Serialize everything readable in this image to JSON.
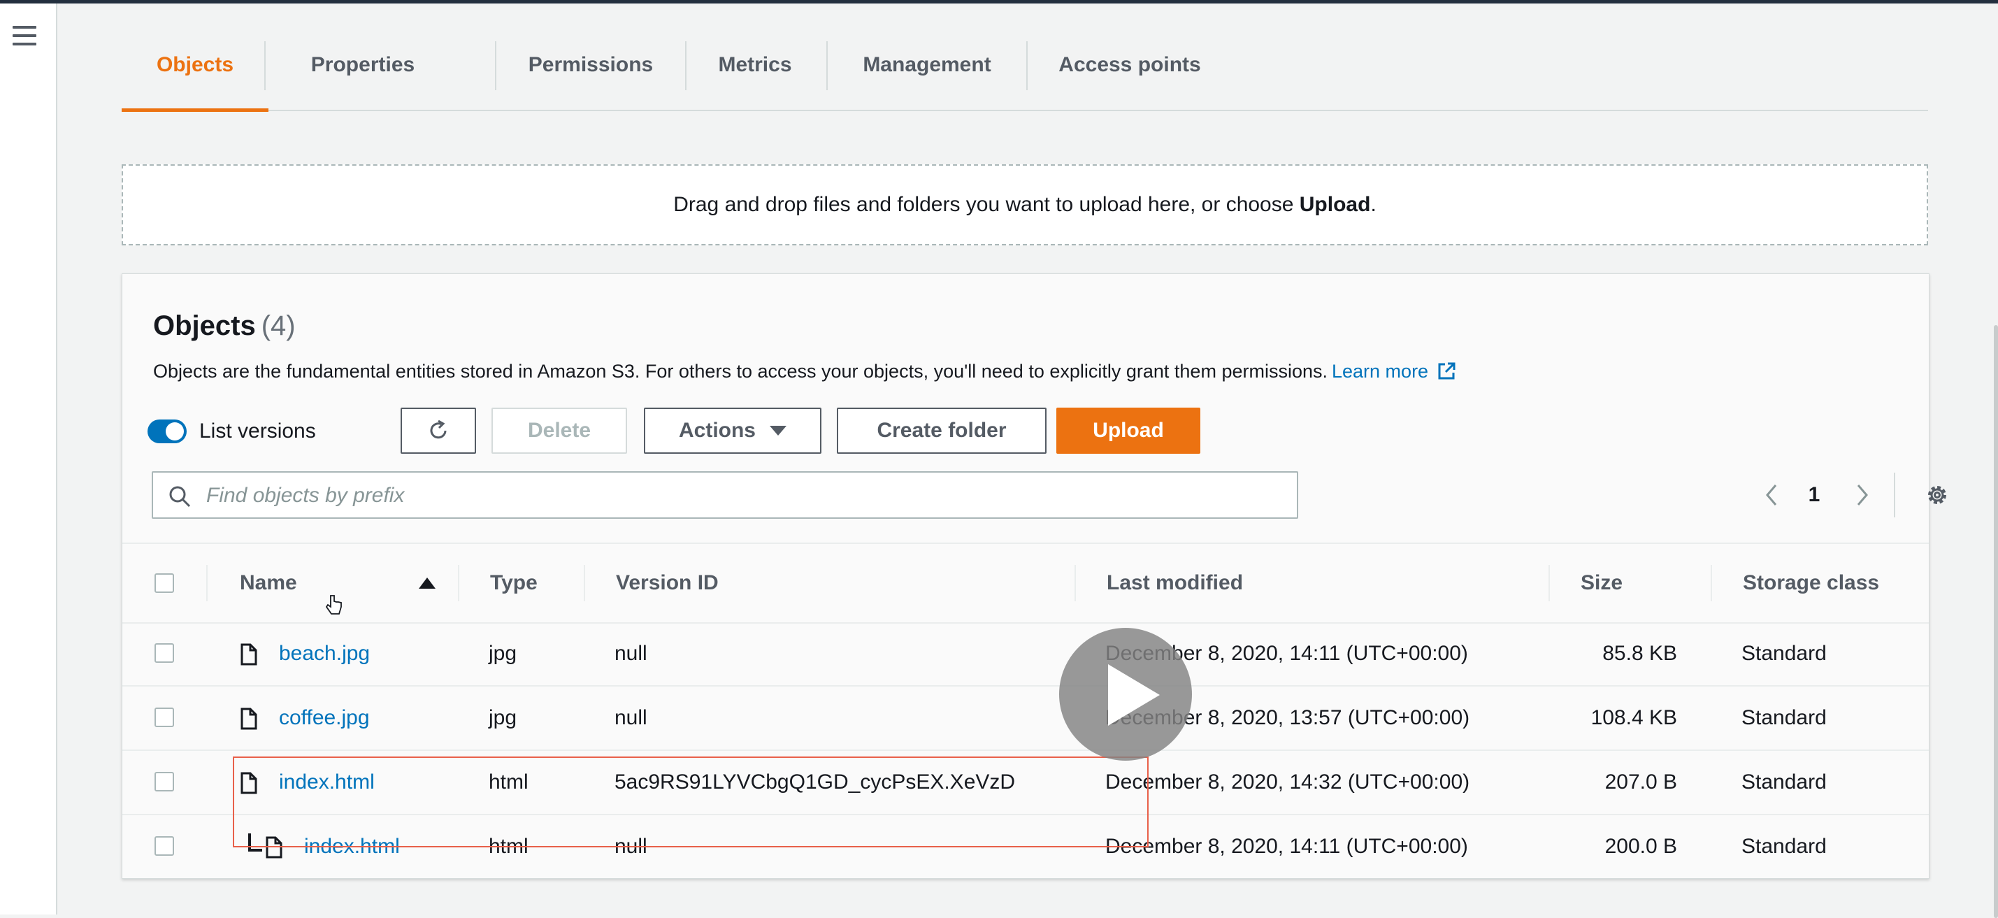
{
  "tabs": [
    {
      "label": "Objects",
      "active": true
    },
    {
      "label": "Properties"
    },
    {
      "label": "Permissions"
    },
    {
      "label": "Metrics"
    },
    {
      "label": "Management"
    },
    {
      "label": "Access points"
    }
  ],
  "dropzone": {
    "text": "Drag and drop files and folders you want to upload here, or choose ",
    "emphasis": "Upload",
    "suffix": "."
  },
  "objects": {
    "title": "Objects",
    "count": "(4)",
    "description": "Objects are the fundamental entities stored in Amazon S3. For others to access your objects, you'll need to explicitly grant them permissions.",
    "learn_more": "Learn more"
  },
  "toolbar": {
    "list_versions_label": "List versions",
    "list_versions_on": true,
    "delete_label": "Delete",
    "actions_label": "Actions",
    "create_folder_label": "Create folder",
    "upload_label": "Upload"
  },
  "search": {
    "placeholder": "Find objects by prefix",
    "value": ""
  },
  "pagination": {
    "current_page": "1"
  },
  "table": {
    "columns": [
      "Name",
      "Type",
      "Version ID",
      "Last modified",
      "Size",
      "Storage class"
    ],
    "sort": {
      "column": "Name",
      "direction": "ascending"
    },
    "rows": [
      {
        "name": "beach.jpg",
        "type": "jpg",
        "version_id": "null",
        "last_modified": "December 8, 2020, 14:11 (UTC+00:00)",
        "size": "85.8 KB",
        "storage_class": "Standard"
      },
      {
        "name": "coffee.jpg",
        "type": "jpg",
        "version_id": "null",
        "last_modified": "December 8, 2020, 13:57 (UTC+00:00)",
        "size": "108.4 KB",
        "storage_class": "Standard"
      },
      {
        "name": "index.html",
        "type": "html",
        "version_id": "5ac9RS91LYVCbgQ1GD_cycPsEX.XeVzD",
        "last_modified": "December 8, 2020, 14:32 (UTC+00:00)",
        "size": "207.0 B",
        "storage_class": "Standard"
      },
      {
        "name": "index.html",
        "type": "html",
        "version_id": "null",
        "last_modified": "December 8, 2020, 14:11 (UTC+00:00)",
        "size": "200.0 B",
        "storage_class": "Standard",
        "is_version": true
      }
    ]
  },
  "colors": {
    "accent": "#ec7211",
    "link": "#0073bb",
    "toggle_on": "#0073bb",
    "highlight_box": "#e8604a"
  },
  "icons": [
    "menu-icon",
    "refresh-icon",
    "caret-down-icon",
    "search-icon",
    "chevron-left-icon",
    "chevron-right-icon",
    "settings-icon",
    "file-icon",
    "external-link-icon",
    "sort-ascending-icon",
    "play-icon",
    "pointer-cursor-icon"
  ]
}
